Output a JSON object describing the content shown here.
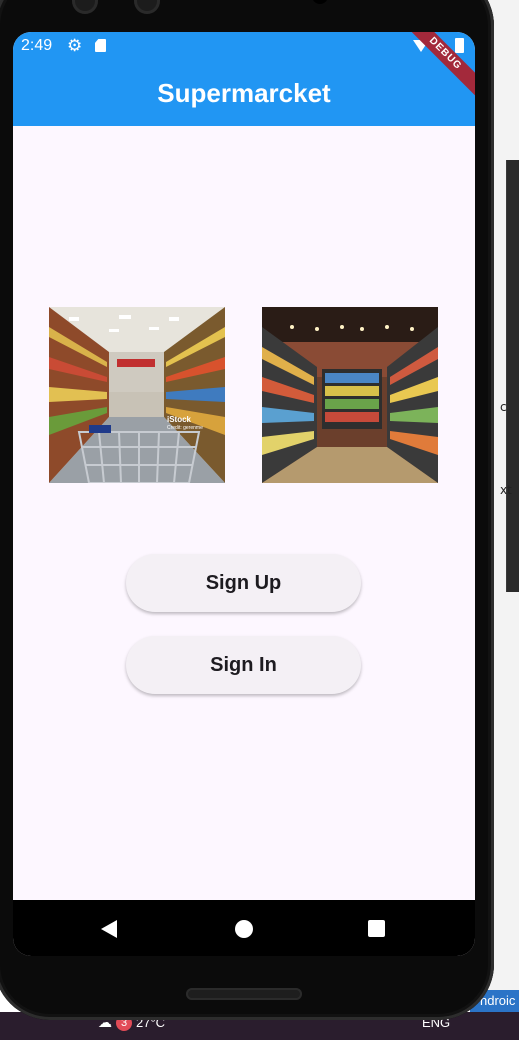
{
  "status_bar": {
    "time": "2:49",
    "icons": [
      "gear-icon",
      "sdcard-icon",
      "wifi-icon",
      "battery-icon"
    ]
  },
  "app_bar": {
    "title": "Supermarcket",
    "color": "#2196f3"
  },
  "debug_banner": "DEBUG",
  "images": [
    {
      "name": "supermarket-aisle-cart-image",
      "watermark": "iStock",
      "credit": "Credit: gerenme"
    },
    {
      "name": "supermarket-shelves-image"
    }
  ],
  "buttons": {
    "sign_up": "Sign Up",
    "sign_in": "Sign In"
  },
  "nav_bar": {
    "icons": [
      "back-icon",
      "home-icon",
      "recents-icon"
    ]
  },
  "desktop": {
    "side_text_1": "c",
    "side_text_2": "xt",
    "ide_label": "ndroic",
    "taskbar": {
      "weather_badge": "3",
      "temperature": "27°C",
      "language": "ENG"
    }
  }
}
